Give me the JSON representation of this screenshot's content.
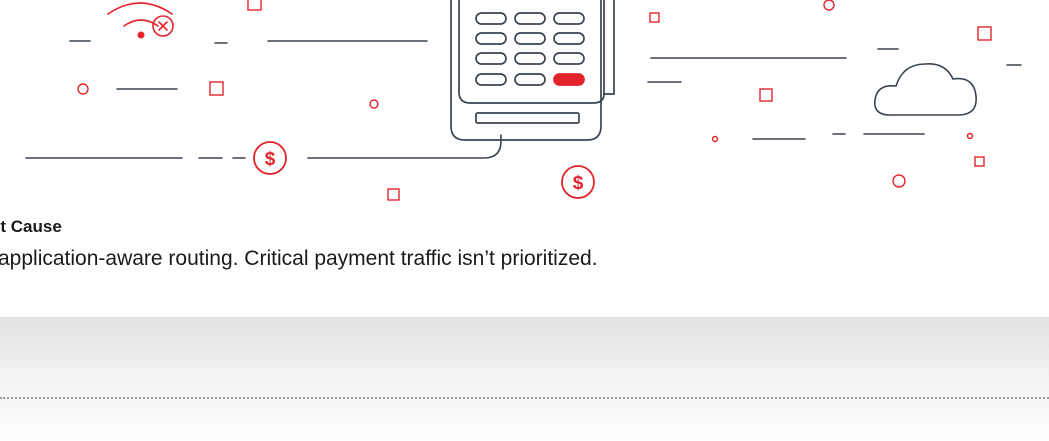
{
  "colors": {
    "ink": "#3a4451",
    "accent": "#e3242b",
    "text": "#1a1a1a"
  },
  "icons": {
    "wifi": "wifi-icon",
    "wifi_error": "wifi-error-icon",
    "terminal": "payment-terminal-icon",
    "cloud": "cloud-icon",
    "dollar": "dollar-coin-icon"
  },
  "illustration": {
    "dollar_symbol": "$"
  },
  "root_cause": {
    "title": "ot Cause",
    "text": "application-aware routing. Critical payment traffic isn’t prioritized."
  }
}
